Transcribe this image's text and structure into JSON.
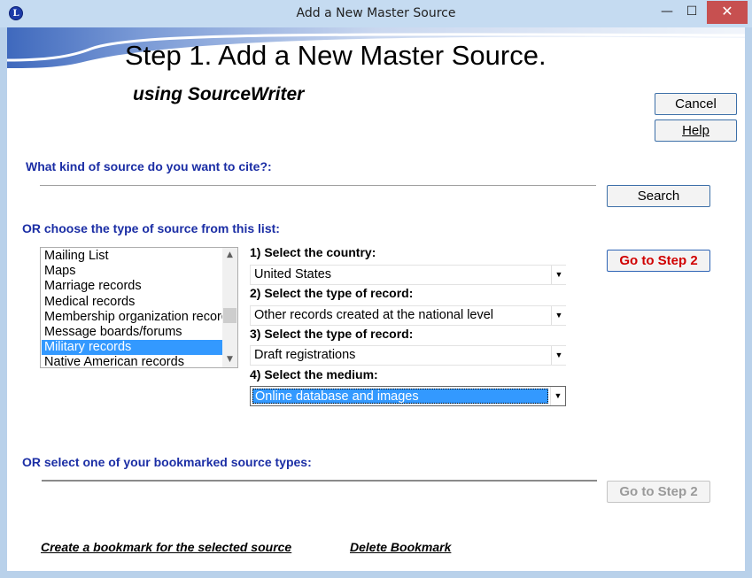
{
  "window": {
    "title": "Add a New Master Source",
    "app_icon_letter": "L",
    "controls": {
      "minimize": "—",
      "maximize": "☐",
      "close": "✕"
    }
  },
  "header": {
    "title": "Step 1.  Add a New Master Source.",
    "subtitle": "using SourceWriter"
  },
  "buttons": {
    "cancel": "Cancel",
    "help": "Help",
    "search": "Search",
    "go_to_step2": "Go to Step 2",
    "go_to_step2_bookmark": "Go to Step 2"
  },
  "search": {
    "prompt": "What kind of source do you want to cite?:",
    "value": ""
  },
  "source_list": {
    "label": "OR choose the type of source from this list:",
    "items": [
      "Mailing List",
      "Maps",
      "Marriage records",
      "Medical records",
      "Membership organization records",
      "Message boards/forums",
      "Military records",
      "Native American records"
    ],
    "selected_index": 6,
    "scroll_up_icon": "▲",
    "scroll_down_icon": "▼"
  },
  "selectors": [
    {
      "label": "1) Select the country:",
      "value": "United States"
    },
    {
      "label": "2) Select the type of record:",
      "value": "Other records created at the national level"
    },
    {
      "label": "3) Select the type of record:",
      "value": "Draft registrations"
    },
    {
      "label": "4) Select the medium:",
      "value": "Online database and images"
    }
  ],
  "dropdown_icon": "▼",
  "bookmarks": {
    "label": "OR select one of your bookmarked source types:",
    "value": ""
  },
  "links": {
    "create_bookmark": "Create a bookmark for the selected source",
    "delete_bookmark": "Delete Bookmark"
  },
  "colors": {
    "accent_blue": "#1b2ea5",
    "selection": "#3399ff",
    "go_button_text": "#d00000",
    "close_button": "#c75050"
  }
}
